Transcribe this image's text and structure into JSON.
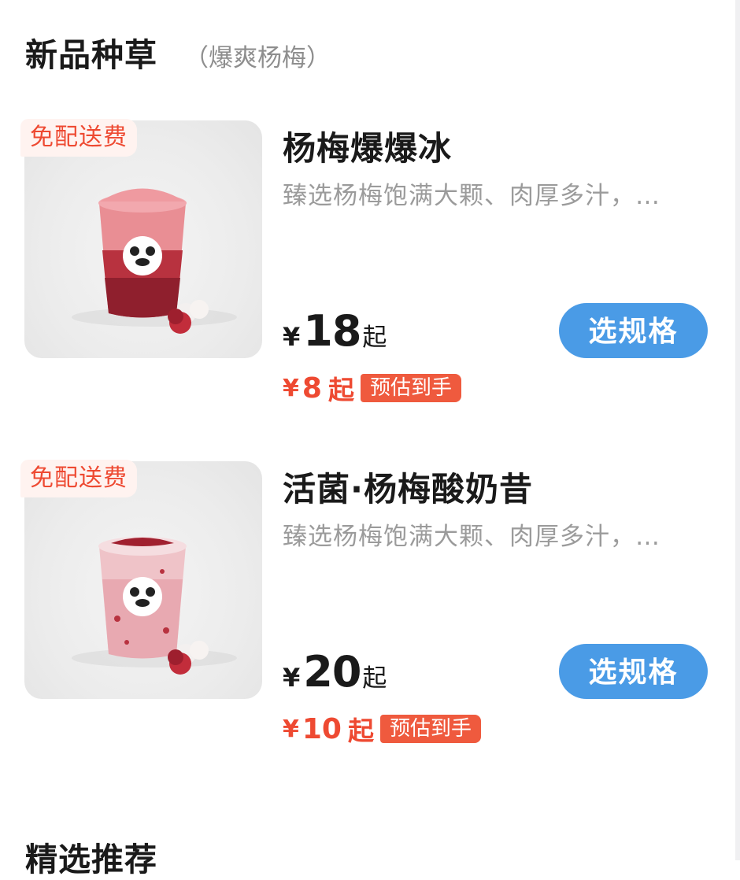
{
  "section": {
    "title": "新品种草",
    "subtitle": "（爆爽杨梅）"
  },
  "products": [
    {
      "badge": "免配送费",
      "name": "杨梅爆爆冰",
      "description": "臻选杨梅饱满大颗、肉厚多汁，…",
      "currency": "¥",
      "price": "18",
      "price_suffix": "起",
      "est_currency": "¥",
      "est_price": "8",
      "est_suffix": "起",
      "est_tag": "预估到手",
      "button_label": "选规格"
    },
    {
      "badge": "免配送费",
      "name": "活菌·杨梅酸奶昔",
      "description": "臻选杨梅饱满大颗、肉厚多汁，…",
      "currency": "¥",
      "price": "20",
      "price_suffix": "起",
      "est_currency": "¥",
      "est_price": "10",
      "est_suffix": "起",
      "est_tag": "预估到手",
      "button_label": "选规格"
    }
  ],
  "next_section": {
    "title": "精选推荐"
  },
  "colors": {
    "accent_blue": "#4a9be6",
    "price_red": "#ee4a32",
    "badge_bg": "#fff3f0"
  }
}
